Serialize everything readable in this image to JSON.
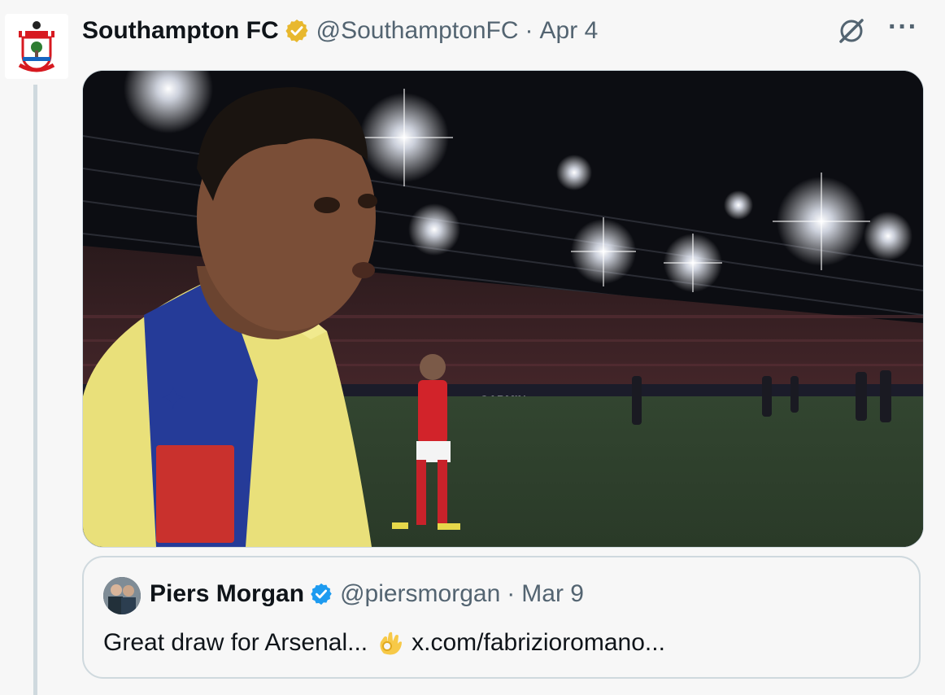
{
  "tweet": {
    "display_name": "Southampton FC",
    "handle": "@SouthamptonFC",
    "separator": "·",
    "date": "Apr 4",
    "more_label": "···",
    "media_alt": "Southampton player looking back at the camera on the pitch at St Mary's with an Arsenal player walking behind, stadium floodlights on",
    "media_board_text": "GARMIN"
  },
  "quote": {
    "display_name": "Piers Morgan",
    "handle": "@piersmorgan",
    "separator": "·",
    "date": "Mar 9",
    "text_before": "Great draw for Arsenal...",
    "emoji": "ok-hand-emoji",
    "link": "x.com/fabrizioromano..."
  },
  "colors": {
    "verified_gold": "#e8b82e",
    "verified_blue": "#1d9bf0",
    "secondary_text": "#536471",
    "border": "#cfd9de"
  }
}
